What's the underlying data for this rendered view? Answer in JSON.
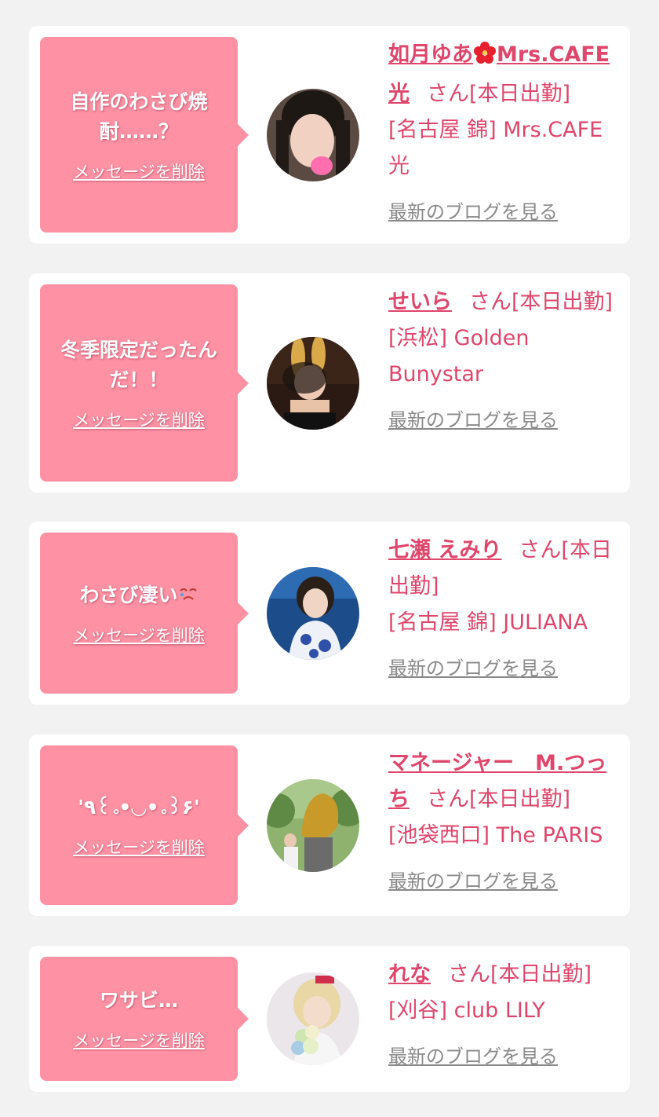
{
  "colors": {
    "background": "#f2f2f2",
    "card": "#ffffff",
    "bubble": "#ff91a4",
    "accent": "#e0456b",
    "link_gray": "#8a8a8a"
  },
  "delete_label": "メッセージを削除",
  "blog_label": "最新のブログを見る",
  "honorific": "さん[本日出勤]",
  "entries": [
    {
      "message_lines": [
        "自作のわさび焼",
        "酎……？"
      ],
      "name_before_icon": "如月ゆあ",
      "name_icon": "hibiscus-icon",
      "name_after_icon": "Mrs.CAFE 光",
      "shop": "[名古屋 錦] Mrs.CAFE 光"
    },
    {
      "message_lines": [
        "冬季限定だったん",
        "だ！！"
      ],
      "name": "せいら",
      "shop": "[浜松] Golden Bunystar"
    },
    {
      "message_lines": [
        "わさび凄い"
      ],
      "message_icon": "crying-face-emoji",
      "name": "七瀬 えみり",
      "shop": "[名古屋 錦] JULIANA"
    },
    {
      "message_lines": [
        "'٩꒰｡•◡•｡꒱۶'"
      ],
      "name": "マネージャー　M.つっち",
      "shop": "[池袋西口] The PARIS"
    },
    {
      "message_lines": [
        "ワサビ…"
      ],
      "name": "れな",
      "shop": "[刈谷] club LILY"
    }
  ]
}
